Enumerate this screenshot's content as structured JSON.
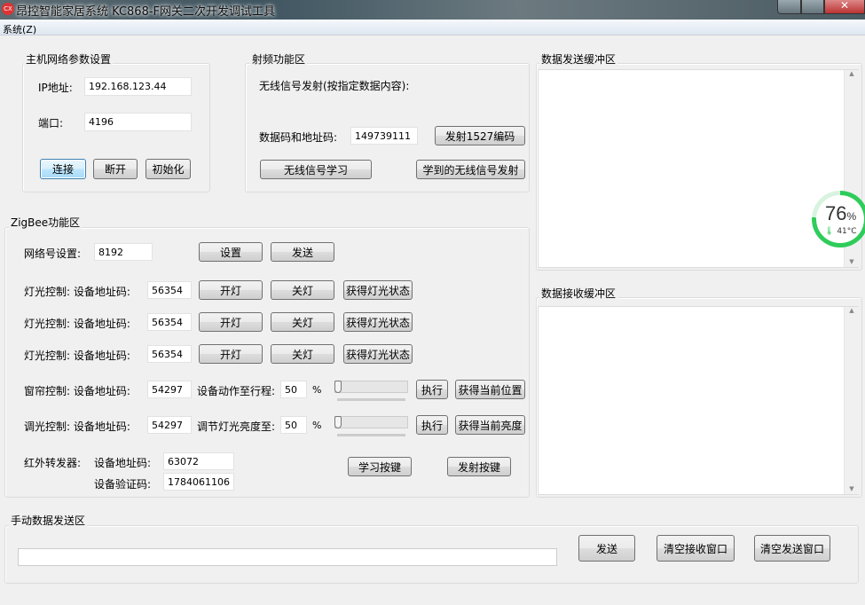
{
  "window": {
    "title": "昂控智能家居系统 KC868-F网关二次开发调试工具",
    "icon": "app-logo-icon"
  },
  "menu": {
    "system": "系统(Z)"
  },
  "host": {
    "title": "主机网络参数设置",
    "ip_label": "IP地址:",
    "ip": "192.168.123.44",
    "port_label": "端口:",
    "port": "4196",
    "connect": "连接",
    "disconnect": "断开",
    "init": "初始化"
  },
  "rf": {
    "title": "射频功能区",
    "desc": "无线信号发射(按指定数据内容):",
    "code_label": "数据码和地址码:",
    "code": "149739111",
    "send1527": "发射1527编码",
    "learn": "无线信号学习",
    "send_learned": "学到的无线信号发射"
  },
  "send_buffer": {
    "title": "数据发送缓冲区",
    "content": ""
  },
  "recv_buffer": {
    "title": "数据接收缓冲区",
    "content": ""
  },
  "zigbee": {
    "title": "ZigBee功能区",
    "net_label": "网络号设置:",
    "net": "8192",
    "set": "设置",
    "send": "发送",
    "lights": [
      {
        "label": "灯光控制: 设备地址码:",
        "addr": "56354",
        "on": "开灯",
        "off": "关灯",
        "status": "获得灯光状态"
      },
      {
        "label": "灯光控制: 设备地址码:",
        "addr": "56354",
        "on": "开灯",
        "off": "关灯",
        "status": "获得灯光状态"
      },
      {
        "label": "灯光控制: 设备地址码:",
        "addr": "56354",
        "on": "开灯",
        "off": "关灯",
        "status": "获得灯光状态"
      }
    ],
    "curtain": {
      "label": "窗帘控制: 设备地址码:",
      "addr": "54297",
      "action_label": "设备动作至行程:",
      "value": "50",
      "unit": "%",
      "slider_percent": 0,
      "exec": "执行",
      "get": "获得当前位置"
    },
    "dimmer": {
      "label": "调光控制: 设备地址码:",
      "addr": "54297",
      "action_label": "调节灯光亮度至:",
      "value": "50",
      "unit": "%",
      "slider_percent": 0,
      "exec": "执行",
      "get": "获得当前亮度"
    },
    "ir": {
      "label": "红外转发器:",
      "addr_label": "设备地址码:",
      "addr": "63072",
      "verify_label": "设备验证码:",
      "verify": "1784061106",
      "learn": "学习按键",
      "send": "发射按键"
    }
  },
  "manual": {
    "title": "手动数据发送区",
    "input": "",
    "send": "发送",
    "clear_recv": "清空接收窗口",
    "clear_send": "清空发送窗口"
  },
  "monitor": {
    "percent": "76",
    "percent_unit": "%",
    "temp": "41°C",
    "color": "#2ecc5a"
  }
}
